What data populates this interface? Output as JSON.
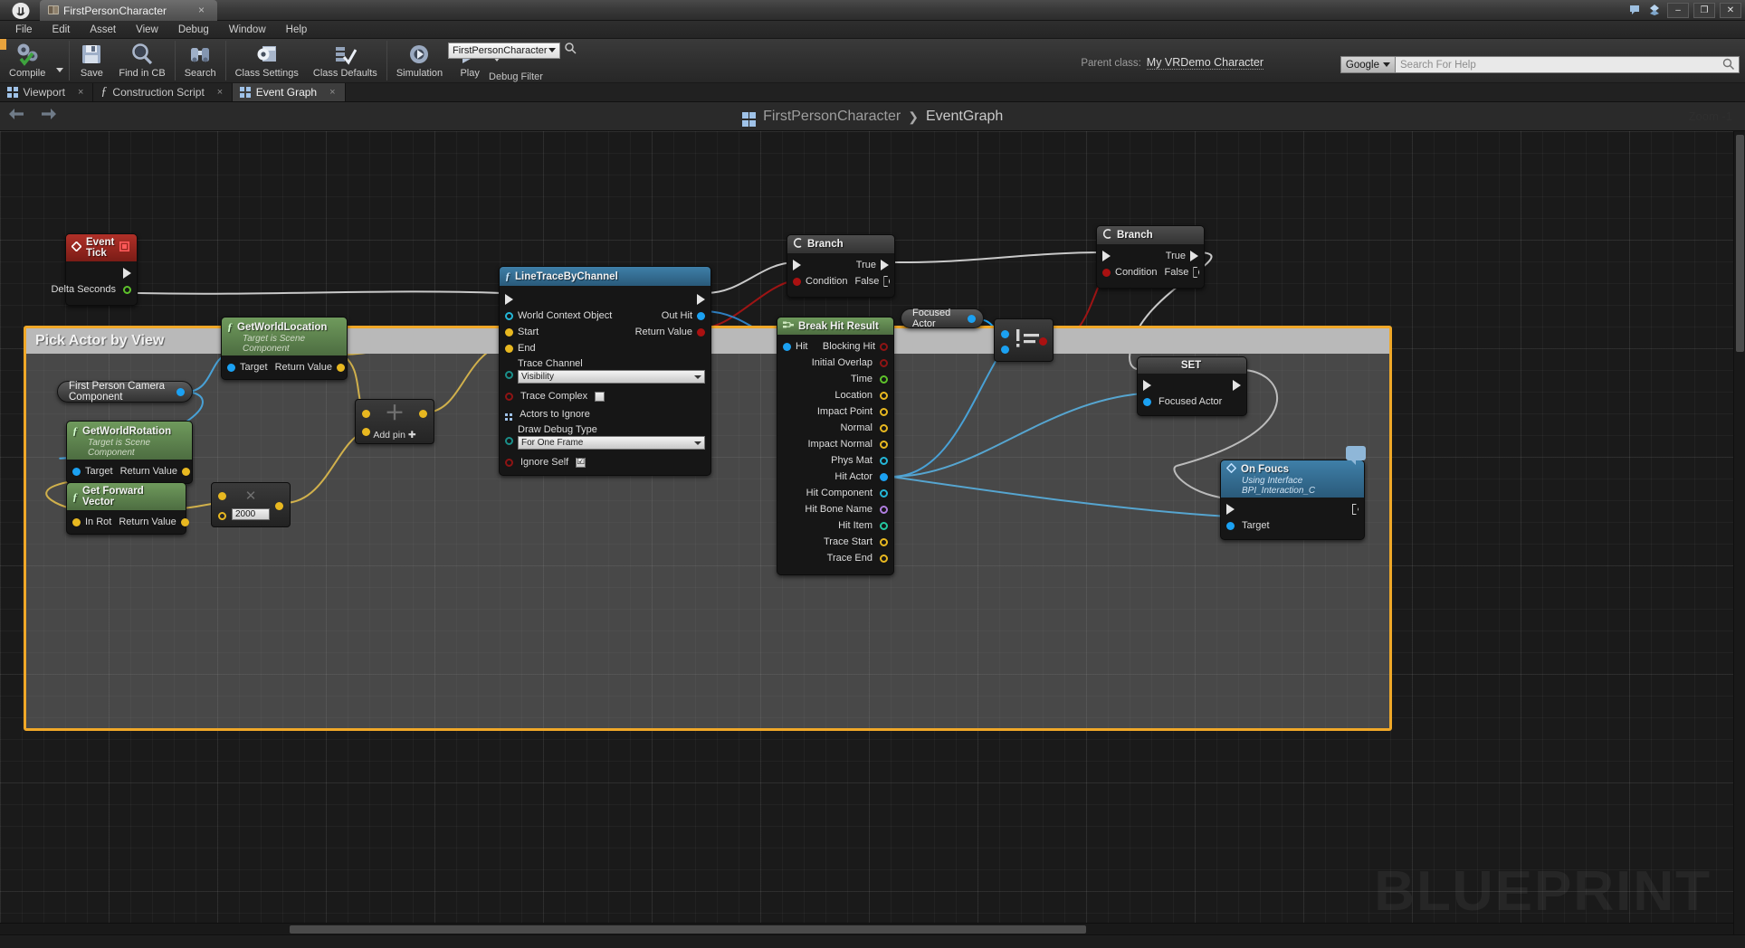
{
  "window": {
    "tab_title": "FirstPersonCharacter",
    "tab_close": "×",
    "minimize": "–",
    "maximize": "❐",
    "close": "✕"
  },
  "menubar": {
    "items": [
      "File",
      "Edit",
      "Asset",
      "View",
      "Debug",
      "Window",
      "Help"
    ]
  },
  "toolbar": {
    "buttons": [
      {
        "label": "Compile",
        "icon": "compile-gears-check-icon"
      },
      {
        "label": "Save",
        "icon": "floppy-disk-icon"
      },
      {
        "label": "Find in CB",
        "icon": "magnifier-icon"
      },
      {
        "label": "Search",
        "icon": "binoculars-icon"
      },
      {
        "label": "Class Settings",
        "icon": "gear-window-icon"
      },
      {
        "label": "Class Defaults",
        "icon": "checklist-icon"
      },
      {
        "label": "Simulation",
        "icon": "gear-play-icon"
      },
      {
        "label": "Play",
        "icon": "play-triangle-icon"
      }
    ],
    "debug_filter_value": "FirstPersonCharacter",
    "debug_filter_label": "Debug Filter"
  },
  "header": {
    "parent_class_label": "Parent class:",
    "parent_class_value": "My VRDemo Character",
    "search_provider": "Google",
    "search_placeholder": "Search For Help"
  },
  "graph_tabs": [
    {
      "label": "Viewport",
      "icon": "viewport-grid-icon",
      "active": false
    },
    {
      "label": "Construction Script",
      "icon": "function-fx-icon",
      "active": false
    },
    {
      "label": "Event Graph",
      "icon": "event-graph-grid-icon",
      "active": true
    }
  ],
  "breadcrumb": {
    "root": "FirstPersonCharacter",
    "separator": "❯",
    "current": "EventGraph"
  },
  "graph": {
    "zoom_label": "Zoom -1",
    "watermark": "BLUEPRINT",
    "comment_title": "Pick Actor by View"
  },
  "nodes": {
    "event_tick": {
      "title": "Event Tick",
      "outputs": [
        "Delta Seconds"
      ]
    },
    "get_world_location": {
      "title": "GetWorldLocation",
      "subtitle": "Target is Scene Component",
      "input": "Target",
      "output": "Return Value"
    },
    "get_world_rotation": {
      "title": "GetWorldRotation",
      "subtitle": "Target is Scene Component",
      "input": "Target",
      "output": "Return Value"
    },
    "first_person_camera": {
      "title": "First Person Camera Component"
    },
    "get_forward_vector": {
      "title": "Get Forward Vector",
      "input": "In Rot",
      "output": "Return Value"
    },
    "multiply": {
      "literal": "2000"
    },
    "add_pin": {
      "label": "Add pin",
      "plus": "✚"
    },
    "line_trace": {
      "title": "LineTraceByChannel",
      "inputs": [
        "World Context Object",
        "Start",
        "End"
      ],
      "trace_channel_label": "Trace Channel",
      "trace_channel_value": "Visibility",
      "trace_complex_label": "Trace Complex",
      "actors_to_ignore_label": "Actors to Ignore",
      "draw_debug_label": "Draw Debug Type",
      "draw_debug_value": "For One Frame",
      "ignore_self_label": "Ignore Self",
      "ignore_self_checked": "☑",
      "outputs": [
        "Out Hit",
        "Return Value"
      ]
    },
    "branch_1": {
      "title": "Branch",
      "condition": "Condition",
      "true": "True",
      "false": "False"
    },
    "branch_2": {
      "title": "Branch",
      "condition": "Condition",
      "true": "True",
      "false": "False"
    },
    "break_hit_result": {
      "title": "Break Hit Result",
      "input": "Hit",
      "outputs": [
        "Blocking Hit",
        "Initial Overlap",
        "Time",
        "Location",
        "Impact Point",
        "Normal",
        "Impact Normal",
        "Phys Mat",
        "Hit Actor",
        "Hit Component",
        "Hit Bone Name",
        "Hit Item",
        "Trace Start",
        "Trace End"
      ]
    },
    "focused_actor_get": {
      "title": "Focused Actor"
    },
    "not_equal": {
      "symbol": "!="
    },
    "set_focused_actor": {
      "title": "SET",
      "pin_label": "Focused Actor"
    },
    "on_focus": {
      "title": "On Foucs",
      "subtitle": "Using Interface BPI_Interaction_C",
      "input": "Target"
    }
  },
  "colors": {
    "accent_orange": "#f0a828",
    "exec_white": "#e4e4e4",
    "object_blue": "#1ba1f2",
    "vector_yellow": "#e8b820",
    "bool_red": "#aa1111",
    "float_green": "#5ec22b",
    "name_purple": "#b07ee0"
  }
}
